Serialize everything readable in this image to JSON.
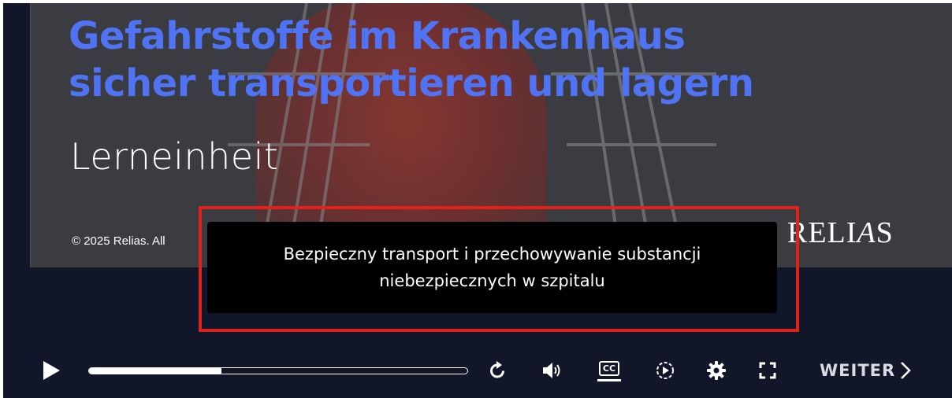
{
  "slide": {
    "title_line1": "Gefahrstoffe im Krankenhaus",
    "title_line2": "sicher transportieren und lagern",
    "subtitle": "Lerneinheit",
    "copyright": "© 2025 Relias. All",
    "logo_text": "RELIAS"
  },
  "caption": {
    "line1": "Bezpieczny transport i przechowywanie substancji",
    "line2": "niebezpiecznych w szpitalu"
  },
  "player": {
    "progress": 0.35,
    "next_label": "WEITER",
    "icons": {
      "play": "play-icon",
      "replay": "replay-icon",
      "volume": "volume-icon",
      "captions": "closed-captions-icon",
      "speed": "playback-speed-icon",
      "settings": "gear-icon",
      "fullscreen": "fullscreen-icon",
      "next": "chevron-right-icon"
    },
    "cc_text": "CC"
  },
  "colors": {
    "title": "#4f73f2",
    "highlight_border": "#e0221c",
    "player_bg": "#111729",
    "caption_bg": "#000000"
  }
}
